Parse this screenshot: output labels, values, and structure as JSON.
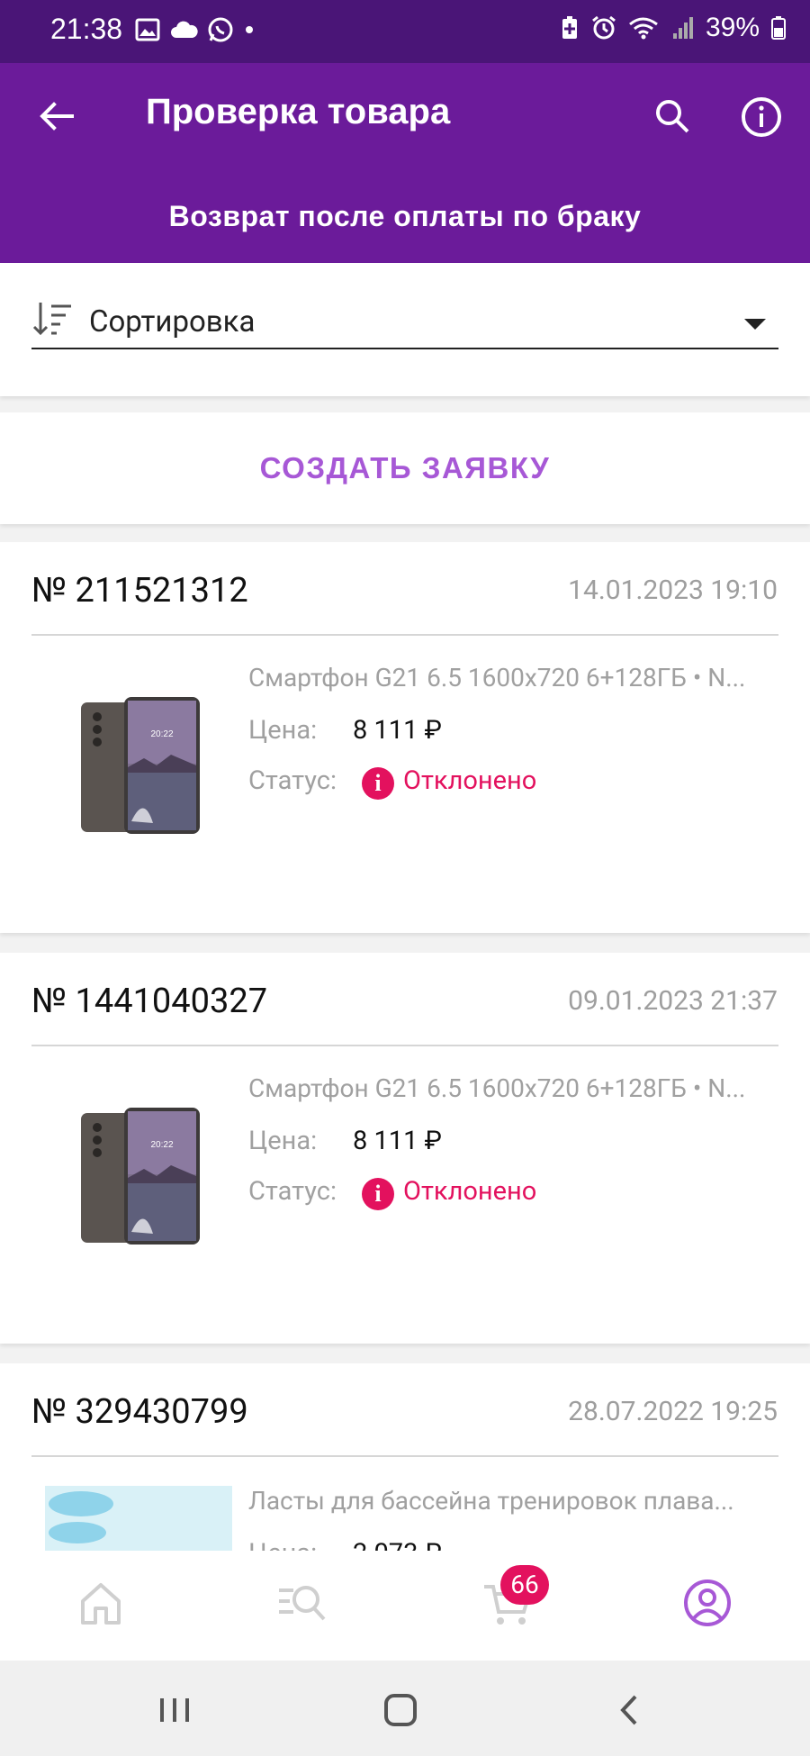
{
  "status_bar": {
    "time": "21:38",
    "battery": "39%",
    "left_icons": [
      "image-icon",
      "cloud-icon",
      "whatsapp-icon",
      "dot-icon"
    ],
    "right_icons": [
      "battery-saver-icon",
      "alarm-icon",
      "wifi-icon",
      "signal-icon",
      "battery-icon"
    ]
  },
  "app_bar": {
    "title": "Проверка товара",
    "subtitle": "Возврат после оплаты по браку",
    "color": "#6b1b9a"
  },
  "sort": {
    "label": "Сортировка"
  },
  "create_button": {
    "label": "СОЗДАТЬ ЗАЯВКУ",
    "color": "#a758d6"
  },
  "labels": {
    "price": "Цена:",
    "status": "Статус:"
  },
  "requests": [
    {
      "number": "№ 211521312",
      "date": "14.01.2023 19:10",
      "product": "Смартфон G21 6.5 1600x720 6+128ГБ • N...",
      "price": "8 111 ₽",
      "status": "Отклонено",
      "image": "phone-image"
    },
    {
      "number": "№ 1441040327",
      "date": "09.01.2023 21:37",
      "product": "Смартфон G21 6.5 1600x720 6+128ГБ • N...",
      "price": "8 111 ₽",
      "status": "Отклонено",
      "image": "phone-image"
    },
    {
      "number": "№ 329430799",
      "date": "28.07.2022 19:25",
      "product": "Ласты для бассейна тренировок плава...",
      "price": "2 073 ₽",
      "status": "",
      "image": "flippers-image"
    }
  ],
  "bottom_nav": {
    "items": [
      "home-icon",
      "catalog-search-icon",
      "cart-icon",
      "profile-icon"
    ],
    "cart_badge": "66",
    "active": "profile-icon",
    "active_color": "#a758d6",
    "inactive_color": "#cfcfcf"
  },
  "colors": {
    "status_rejected": "#e3115e"
  }
}
